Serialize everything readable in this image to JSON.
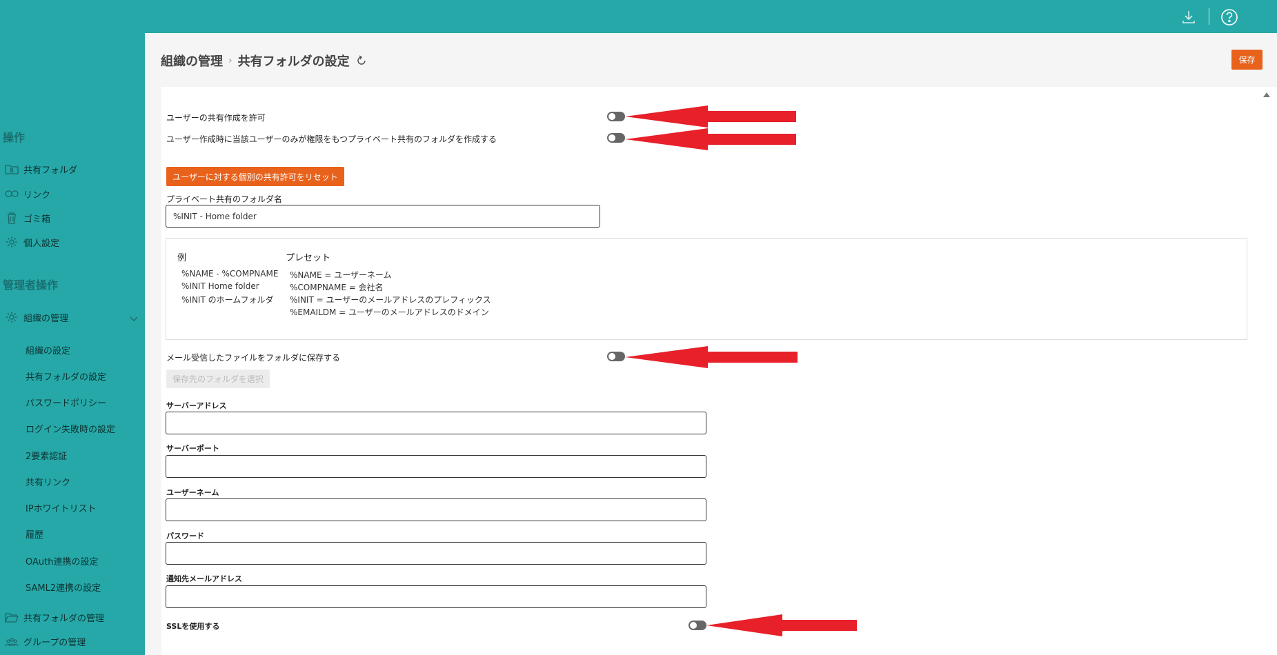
{
  "topbar": {
    "icons": [
      "download-icon",
      "help-icon"
    ],
    "bg_color": "#26a8a8"
  },
  "sidebar": {
    "section_ops": "操作",
    "items": [
      {
        "label": "共有フォルダ",
        "icon": "shared-folder-icon"
      },
      {
        "label": "リンク",
        "icon": "link-icon"
      },
      {
        "label": "ゴミ箱",
        "icon": "trash-icon"
      },
      {
        "label": "個人設定",
        "icon": "gear-icon"
      }
    ],
    "section_admin": "管理者操作",
    "org_mgmt": {
      "label": "組織の管理",
      "icon": "gear-icon"
    },
    "sub_items": [
      "組織の設定",
      "共有フォルダの設定",
      "パスワードポリシー",
      "ログイン失敗時の設定",
      "2要素認証",
      "共有リンク",
      "IPホワイトリスト",
      "履歴",
      "OAuth連携の設定",
      "SAML2連携の設定"
    ],
    "folder_mgmt": {
      "label": "共有フォルダの管理",
      "icon": "folder-open-icon"
    },
    "group_mgmt": {
      "label": "グループの管理",
      "icon": "group-icon"
    }
  },
  "header": {
    "breadcrumb_parent": "組織の管理",
    "breadcrumb_current": "共有フォルダの設定",
    "save_label": "保存"
  },
  "form": {
    "allow_share_label": "ユーザーの共有作成を許可",
    "private_share_label": "ユーザー作成時に当該ユーザーのみが権限をもつプライベート共有のフォルダを作成する",
    "reset_button": "ユーザーに対する個別の共有許可をリセット",
    "private_folder_name_label": "プライベート共有のフォルダ名",
    "private_folder_name_value": "%INIT - Home folder",
    "example_head": "例",
    "preset_head": "プレセット",
    "examples": [
      "%NAME - %COMPNAME",
      "%INIT Home folder",
      "%INIT のホームフォルダ"
    ],
    "presets": [
      "%NAME = ユーザーネーム",
      "%COMPNAME = 会社名",
      "%INIT = ユーザーのメールアドレスのプレフィックス",
      "%EMAILDM = ユーザーのメールアドレスのドメイン"
    ],
    "mail_save_label": "メール受信したファイルをフォルダに保存する",
    "select_folder_button": "保存先のフォルダを選択",
    "server_address_label": "サーバーアドレス",
    "server_port_label": "サーバーポート",
    "username_label": "ユーザーネーム",
    "password_label": "パスワード",
    "notify_email_label": "通知先メールアドレス",
    "ssl_label": "SSLを使用する"
  },
  "colors": {
    "accent": "#e8621c",
    "sidebar": "#26a8a8",
    "arrow": "#e8202a"
  }
}
